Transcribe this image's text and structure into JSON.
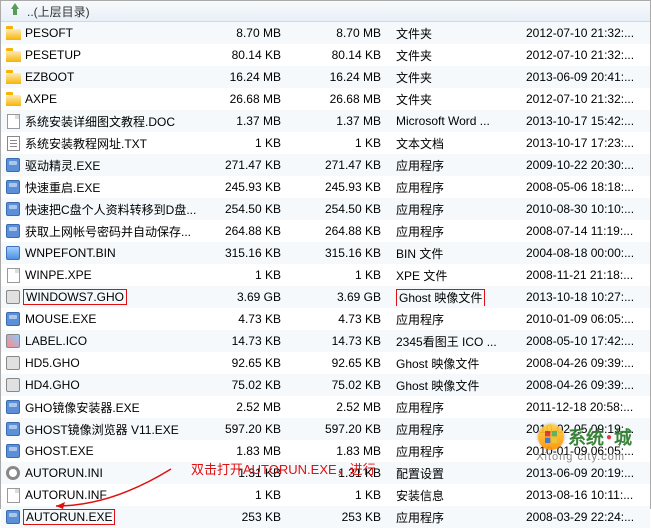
{
  "header": {
    "parent_dir": "..(上层目录)"
  },
  "rows": [
    {
      "icon": "folder",
      "name": "PESOFT",
      "size": "8.70 MB",
      "size2": "8.70 MB",
      "type": "文件夹",
      "date": "2012-07-10 21:32:..."
    },
    {
      "icon": "folder",
      "name": "PESETUP",
      "size": "80.14 KB",
      "size2": "80.14 KB",
      "type": "文件夹",
      "date": "2012-07-10 21:32:..."
    },
    {
      "icon": "folder",
      "name": "EZBOOT",
      "size": "16.24 MB",
      "size2": "16.24 MB",
      "type": "文件夹",
      "date": "2013-06-09 20:41:..."
    },
    {
      "icon": "folder",
      "name": "AXPE",
      "size": "26.68 MB",
      "size2": "26.68 MB",
      "type": "文件夹",
      "date": "2012-07-10 21:32:..."
    },
    {
      "icon": "doc",
      "name": "系统安装详细图文教程.DOC",
      "size": "1.37 MB",
      "size2": "1.37 MB",
      "type": "Microsoft Word ...",
      "date": "2013-10-17 15:42:..."
    },
    {
      "icon": "txt",
      "name": "系统安装教程网址.TXT",
      "size": "1 KB",
      "size2": "1 KB",
      "type": "文本文档",
      "date": "2013-10-17 17:23:..."
    },
    {
      "icon": "exe",
      "name": "驱动精灵.EXE",
      "size": "271.47 KB",
      "size2": "271.47 KB",
      "type": "应用程序",
      "date": "2009-10-22 20:30:..."
    },
    {
      "icon": "exe",
      "name": "快速重启.EXE",
      "size": "245.93 KB",
      "size2": "245.93 KB",
      "type": "应用程序",
      "date": "2008-05-06 18:18:..."
    },
    {
      "icon": "exe",
      "name": "快速把C盘个人资料转移到D盘...",
      "size": "254.50 KB",
      "size2": "254.50 KB",
      "type": "应用程序",
      "date": "2010-08-30 10:10:..."
    },
    {
      "icon": "exe",
      "name": "获取上网帐号密码并自动保存...",
      "size": "264.88 KB",
      "size2": "264.88 KB",
      "type": "应用程序",
      "date": "2008-07-14 11:19:..."
    },
    {
      "icon": "img",
      "name": "WNPEFONT.BIN",
      "size": "315.16 KB",
      "size2": "315.16 KB",
      "type": "BIN 文件",
      "date": "2004-08-18 00:00:..."
    },
    {
      "icon": "doc",
      "name": "WINPE.XPE",
      "size": "1 KB",
      "size2": "1 KB",
      "type": "XPE 文件",
      "date": "2008-11-21 21:18:..."
    },
    {
      "icon": "gho",
      "name": "WINDOWS7.GHO",
      "size": "3.69 GB",
      "size2": "3.69 GB",
      "type": "Ghost 映像文件",
      "date": "2013-10-18 10:27:...",
      "hl": true,
      "hlType": true
    },
    {
      "icon": "exe",
      "name": "MOUSE.EXE",
      "size": "4.73 KB",
      "size2": "4.73 KB",
      "type": "应用程序",
      "date": "2010-01-09 06:05:..."
    },
    {
      "icon": "ico",
      "name": "LABEL.ICO",
      "size": "14.73 KB",
      "size2": "14.73 KB",
      "type": "2345看图王 ICO ...",
      "date": "2008-05-10 17:42:..."
    },
    {
      "icon": "gho",
      "name": "HD5.GHO",
      "size": "92.65 KB",
      "size2": "92.65 KB",
      "type": "Ghost 映像文件",
      "date": "2008-04-26 09:39:..."
    },
    {
      "icon": "gho",
      "name": "HD4.GHO",
      "size": "75.02 KB",
      "size2": "75.02 KB",
      "type": "Ghost 映像文件",
      "date": "2008-04-26 09:39:..."
    },
    {
      "icon": "exe",
      "name": "GHO镜像安装器.EXE",
      "size": "2.52 MB",
      "size2": "2.52 MB",
      "type": "应用程序",
      "date": "2011-12-18 20:58:..."
    },
    {
      "icon": "exe",
      "name": "GHOST镜像浏览器 V11.EXE",
      "size": "597.20 KB",
      "size2": "597.20 KB",
      "type": "应用程序",
      "date": "2010-02-05 09:19:..."
    },
    {
      "icon": "exe",
      "name": "GHOST.EXE",
      "size": "1.83 MB",
      "size2": "1.83 MB",
      "type": "应用程序",
      "date": "2010-01-09 06:05:..."
    },
    {
      "icon": "cog",
      "name": "AUTORUN.INI",
      "size": "1.31 KB",
      "size2": "1.31 KB",
      "type": "配置设置",
      "date": "2013-06-09 20:19:..."
    },
    {
      "icon": "doc",
      "name": "AUTORUN.INF",
      "size": "1 KB",
      "size2": "1 KB",
      "type": "安装信息",
      "date": "2013-08-16 10:11:..."
    },
    {
      "icon": "exe",
      "name": "AUTORUN.EXE",
      "size": "253 KB",
      "size2": "253 KB",
      "type": "应用程序",
      "date": "2008-03-29 22:24:...",
      "hl": true
    }
  ],
  "annotation": {
    "text": "双击打开AUTORUN.EXE，进行"
  },
  "watermark": {
    "brand1": "系统",
    "brand2": "城",
    "url": "Xitong city.com"
  }
}
